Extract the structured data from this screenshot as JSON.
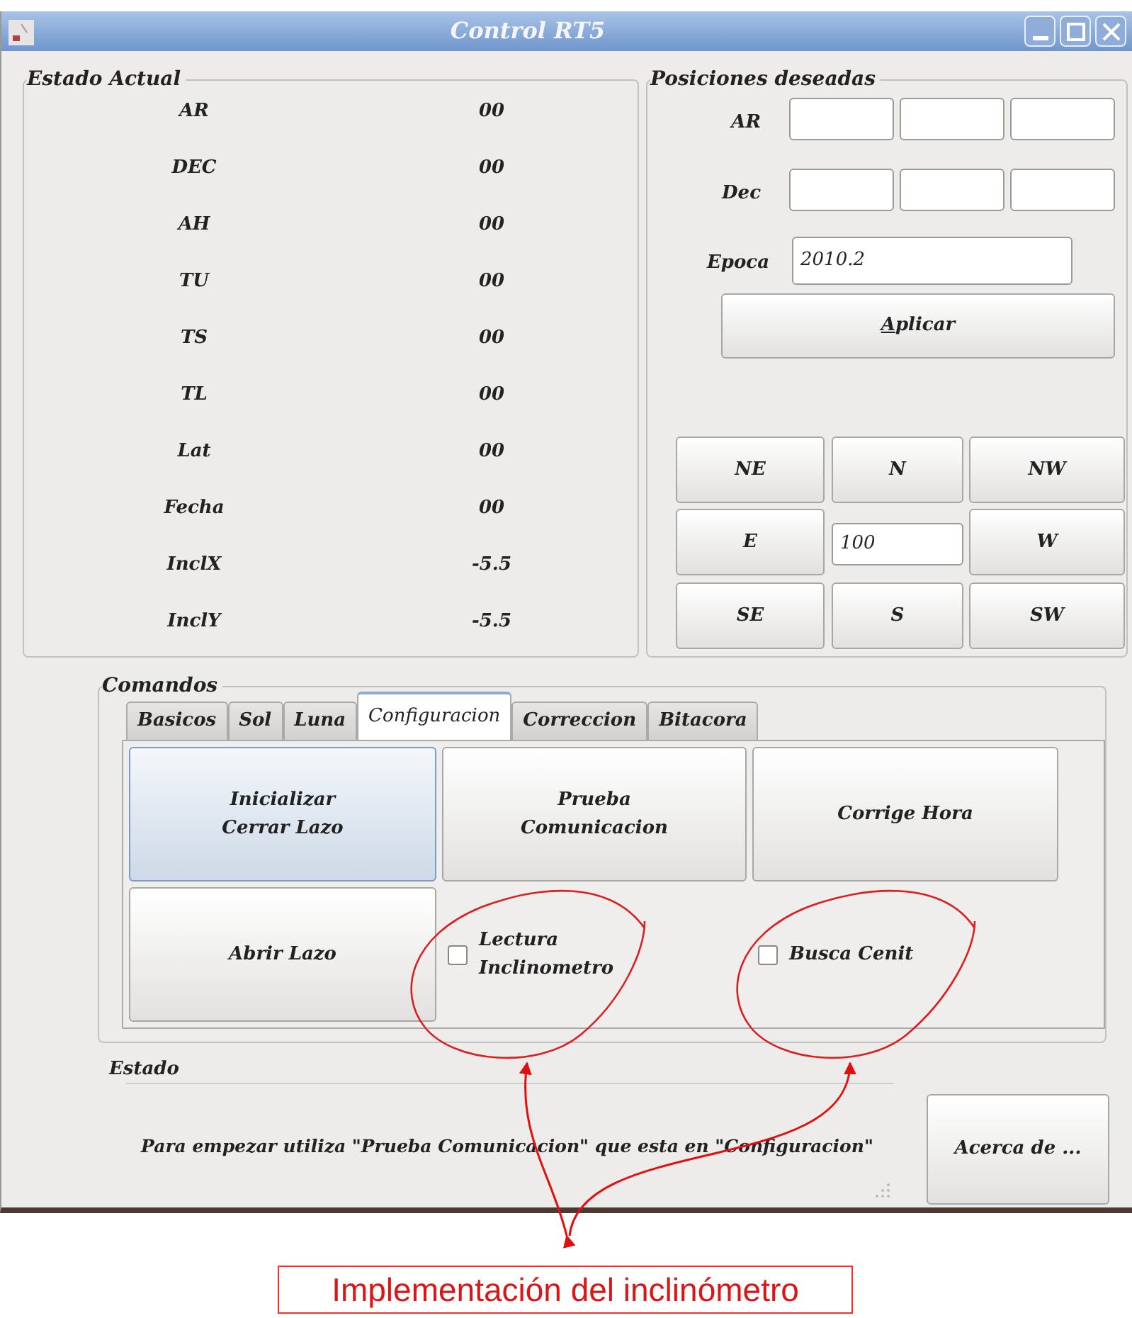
{
  "window": {
    "title": "Control RT5"
  },
  "estado_actual": {
    "title": "Estado Actual",
    "rows": [
      {
        "label": "AR",
        "value": "00"
      },
      {
        "label": "DEC",
        "value": "00"
      },
      {
        "label": "AH",
        "value": "00"
      },
      {
        "label": "TU",
        "value": "00"
      },
      {
        "label": "TS",
        "value": "00"
      },
      {
        "label": "TL",
        "value": "00"
      },
      {
        "label": "Lat",
        "value": "00"
      },
      {
        "label": "Fecha",
        "value": "00"
      },
      {
        "label": "InclX",
        "value": "-5.5"
      },
      {
        "label": "InclY",
        "value": "-5.5"
      }
    ]
  },
  "posiciones": {
    "title": "Posiciones deseadas",
    "coords": [
      {
        "label": "AR"
      },
      {
        "label": "Dec"
      }
    ],
    "epoca": {
      "label": "Epoca",
      "value": "2010.2"
    },
    "apply_button": {
      "label": "Aplicar",
      "mnemonic": true
    },
    "jog": [
      {
        "kind": "button",
        "label": "NE"
      },
      {
        "kind": "button",
        "label": "N"
      },
      {
        "kind": "button",
        "label": "NW"
      },
      {
        "kind": "button",
        "label": "E"
      },
      {
        "kind": "field",
        "value": "100"
      },
      {
        "kind": "button",
        "label": "W"
      },
      {
        "kind": "button",
        "label": "SE"
      },
      {
        "kind": "button",
        "label": "S"
      },
      {
        "kind": "button",
        "label": "SW"
      }
    ]
  },
  "comandos": {
    "title": "Comandos",
    "tabs": [
      {
        "label": "Basicos",
        "selected": false
      },
      {
        "label": "Sol",
        "selected": false
      },
      {
        "label": "Luna",
        "selected": false
      },
      {
        "label": "Configuracion",
        "selected": true
      },
      {
        "label": "Correccion",
        "selected": false
      },
      {
        "label": "Bitacora",
        "selected": false
      }
    ],
    "items": [
      {
        "kind": "button",
        "label": "Inicializar\nCerrar Lazo",
        "focused": true
      },
      {
        "kind": "button",
        "label": "Prueba\nComunicacion",
        "focused": false
      },
      {
        "kind": "button",
        "label": "Corrige Hora",
        "focused": false
      },
      {
        "kind": "button",
        "label": "Abrir Lazo",
        "focused": false
      },
      {
        "kind": "checkbox",
        "label": "Lectura\nInclinometro",
        "checked": false
      },
      {
        "kind": "checkbox",
        "label": "Busca Cenit",
        "checked": false
      }
    ]
  },
  "estado": {
    "title": "Estado",
    "message": "Para empezar utiliza \"Prueba Comunicacion\" que esta en \"Configuracion\"",
    "about_button": "Acerca de ..."
  },
  "annotation": {
    "label": "Implementación del inclinómetro"
  }
}
